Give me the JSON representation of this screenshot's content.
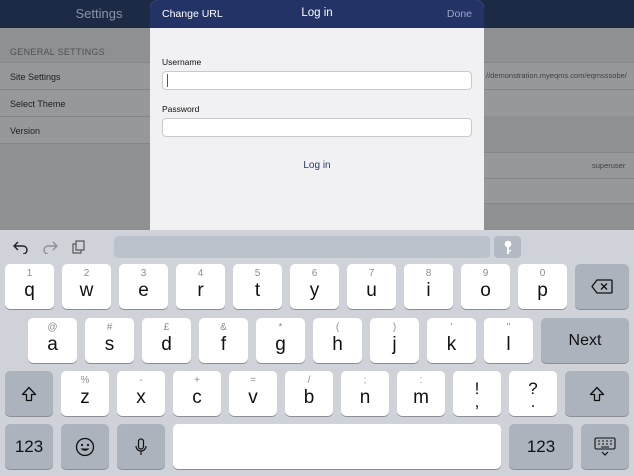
{
  "background": {
    "nav_title": "Settings",
    "section_header": "GENERAL SETTINGS",
    "rows": [
      "Site Settings",
      "Select Theme",
      "Version"
    ],
    "site_url": "//demonstration.myeqms.com/eqmsssobe/",
    "user": "superuser"
  },
  "modal": {
    "left_button": "Change URL",
    "title": "Log in",
    "right_button": "Done",
    "username_label": "Username",
    "username_value": "",
    "password_label": "Password",
    "password_value": "",
    "login_button": "Log in"
  },
  "keyboard": {
    "toolbar": {
      "undo_icon": "undo-icon",
      "redo_icon": "redo-icon",
      "paste_icon": "paste-icon",
      "keychain_icon": "key-icon"
    },
    "row1": [
      {
        "hint": "1",
        "key": "q"
      },
      {
        "hint": "2",
        "key": "w"
      },
      {
        "hint": "3",
        "key": "e"
      },
      {
        "hint": "4",
        "key": "r"
      },
      {
        "hint": "5",
        "key": "t"
      },
      {
        "hint": "6",
        "key": "y"
      },
      {
        "hint": "7",
        "key": "u"
      },
      {
        "hint": "8",
        "key": "i"
      },
      {
        "hint": "9",
        "key": "o"
      },
      {
        "hint": "0",
        "key": "p"
      }
    ],
    "row2": [
      {
        "hint": "@",
        "key": "a"
      },
      {
        "hint": "#",
        "key": "s"
      },
      {
        "hint": "£",
        "key": "d"
      },
      {
        "hint": "&",
        "key": "f"
      },
      {
        "hint": "*",
        "key": "g"
      },
      {
        "hint": "(",
        "key": "h"
      },
      {
        "hint": ")",
        "key": "j"
      },
      {
        "hint": "'",
        "key": "k"
      },
      {
        "hint": "\"",
        "key": "l"
      }
    ],
    "row3": [
      {
        "hint": "%",
        "key": "z"
      },
      {
        "hint": "-",
        "key": "x"
      },
      {
        "hint": "+",
        "key": "c"
      },
      {
        "hint": "=",
        "key": "v"
      },
      {
        "hint": "/",
        "key": "b"
      },
      {
        "hint": ";",
        "key": "n"
      },
      {
        "hint": ":",
        "key": "m"
      }
    ],
    "punct1": {
      "top": "!",
      "bottom": ","
    },
    "punct2": {
      "top": "?",
      "bottom": "."
    },
    "next_label": "Next",
    "numbers_label": "123",
    "backspace_icon": "backspace-icon",
    "shift_icon": "shift-icon",
    "emoji_icon": "emoji-icon",
    "mic_icon": "microphone-icon",
    "dismiss_icon": "keyboard-dismiss-icon"
  },
  "colors": {
    "modal_bar": "#233366",
    "link": "#233a75",
    "keyboard_bg": "#cfd3d9"
  }
}
